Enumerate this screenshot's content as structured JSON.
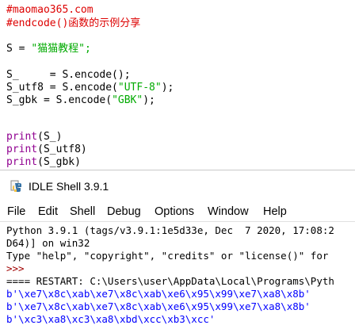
{
  "editor": {
    "lines": [
      {
        "text": "#maomao365.com",
        "kind": "comment"
      },
      {
        "text": "#endcode()函数的示例分享",
        "kind": "comment"
      },
      {
        "text": "S = ",
        "kind": "normal",
        "rest": "\"猫猫教程\";"
      },
      {
        "text": "S_     = S.encode();",
        "kind": "normal"
      },
      {
        "text": "S_utf8 = S.encode(",
        "kind": "normal",
        "str": "\"UTF-8\"",
        "end": ");"
      },
      {
        "text": "S_gbk = S.encode(",
        "kind": "normal",
        "str": "\"GBK\"",
        "end": ");"
      },
      {
        "text": "print",
        "kind": "builtin",
        "rest": "(S_)"
      },
      {
        "text": "print",
        "kind": "builtin",
        "rest": "(S_utf8)"
      },
      {
        "text": "print",
        "kind": "builtin",
        "rest": "(S_gbk)"
      }
    ]
  },
  "shell": {
    "title": "IDLE Shell 3.9.1",
    "menu": [
      "File",
      "Edit",
      "Shell",
      "Debug",
      "Options",
      "Window",
      "Help"
    ],
    "output": [
      {
        "text": "Python 3.9.1 (tags/v3.9.1:1e5d33e, Dec  7 2020, 17:08:2",
        "kind": "normal"
      },
      {
        "text": "D64)] on win32",
        "kind": "normal"
      },
      {
        "text": "Type \"help\", \"copyright\", \"credits\" or \"license()\" for",
        "kind": "normal"
      },
      {
        "text": ">>>",
        "kind": "prompt"
      },
      {
        "text": "==== RESTART: C:\\Users\\user\\AppData\\Local\\Programs\\Pyth",
        "kind": "normal"
      },
      {
        "text": "b'\\xe7\\x8c\\xab\\xe7\\x8c\\xab\\xe6\\x95\\x99\\xe7\\xa8\\x8b'",
        "kind": "stdout"
      },
      {
        "text": "b'\\xe7\\x8c\\xab\\xe7\\x8c\\xab\\xe6\\x95\\x99\\xe7\\xa8\\x8b'",
        "kind": "stdout"
      },
      {
        "text": "b'\\xc3\\xa8\\xc3\\xa8\\xbd\\xcc\\xb3\\xcc'",
        "kind": "stdout"
      }
    ]
  },
  "colors": {
    "comment": "#dd0000",
    "string": "#00aa00",
    "builtin": "#900090",
    "stdout": "#0000ff",
    "prompt": "#a00000"
  },
  "icons": {
    "title": "python-idle-icon"
  }
}
